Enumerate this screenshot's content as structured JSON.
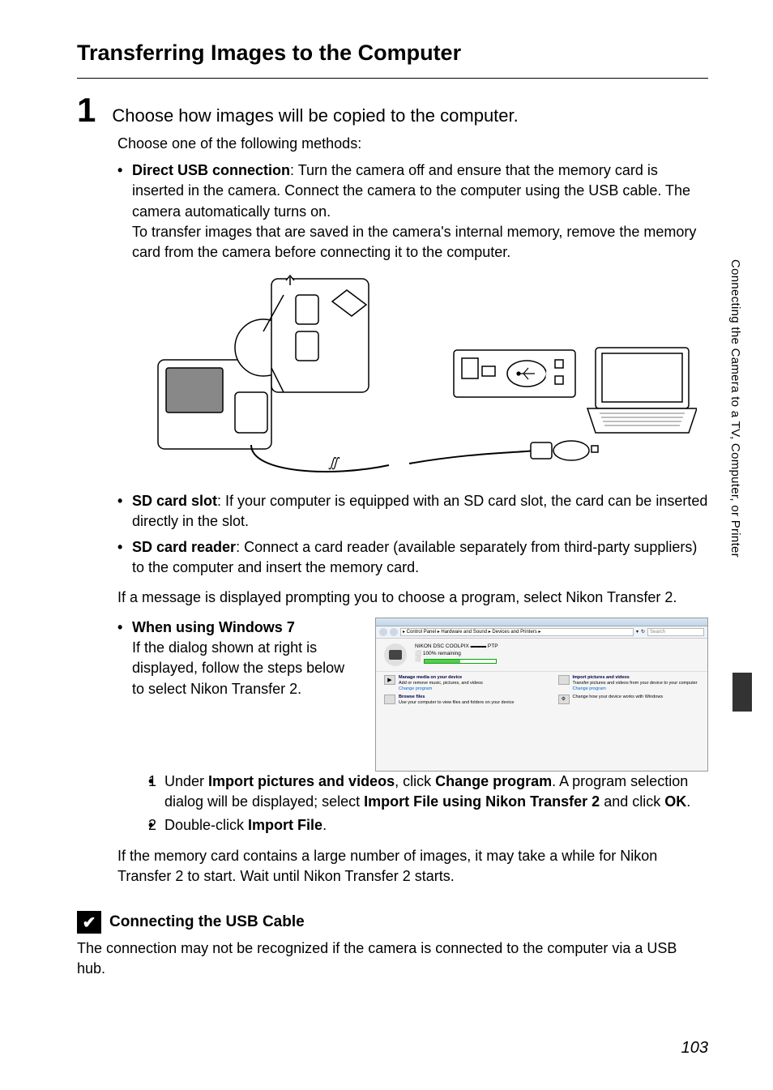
{
  "heading": "Transferring Images to the Computer",
  "step": {
    "number": "1",
    "title": "Choose how images will be copied to the computer.",
    "intro": "Choose one of the following methods:",
    "bullets": {
      "usb": {
        "label": "Direct USB connection",
        "text1": ": Turn the camera off and ensure that the memory card is inserted in the camera. Connect the camera to the computer using the USB cable. The camera automatically turns on.",
        "text2": "To transfer images that are saved in the camera's internal memory, remove the memory card from the camera before connecting it to the computer."
      },
      "sdslot": {
        "label": "SD card slot",
        "text": ": If your computer is equipped with an SD card slot, the card can be inserted directly in the slot."
      },
      "sdreader": {
        "label": "SD card reader",
        "text": ": Connect a card reader (available separately from third-party suppliers) to the computer and insert the memory card."
      }
    },
    "message_para": "If a message is displayed prompting you to choose a program, select Nikon Transfer 2.",
    "win7": {
      "bullet": "When using Windows 7",
      "text": "If the dialog shown at right is displayed, follow the steps below to select Nikon Transfer 2.",
      "list": {
        "item1": {
          "num": "1",
          "pre": "Under ",
          "bold1": "Import pictures and videos",
          "mid1": ", click ",
          "bold2": "Change program",
          "mid2": ". A program selection dialog will be displayed; select ",
          "bold3": "Import File using Nikon Transfer 2",
          "mid3": " and click ",
          "bold4": "OK",
          "end": "."
        },
        "item2": {
          "num": "2",
          "pre": "Double-click ",
          "bold": "Import File",
          "end": "."
        }
      }
    },
    "final_para": "If the memory card contains a large number of images, it may take a while for Nikon Transfer 2 to start. Wait until Nikon Transfer 2 starts."
  },
  "win7_screenshot": {
    "breadcrumb": "▸ Control Panel ▸ Hardware and Sound ▸ Devices and Printers ▸",
    "search": "Search",
    "device_name": "NIKON DSC COOLPIX ▬▬▬ PTP",
    "remaining": "⬜ 100% remaining",
    "manage_title": "Manage media on your device",
    "manage_sub": "Add or remove music, pictures, and videos",
    "manage_link": "Change program",
    "browse_title": "Browse files",
    "browse_sub": "Use your computer to view files and folders on your device",
    "import_title": "Import pictures and videos",
    "import_sub": "Transfer pictures and videos from your device to your computer",
    "import_link": "Change program",
    "changehow_sub": "Change how your device works with Windows"
  },
  "note": {
    "icon": "✔",
    "title": "Connecting the USB Cable",
    "body": "The connection may not be recognized if the camera is connected to the computer via a USB hub."
  },
  "side_text": "Connecting the Camera to a TV, Computer, or Printer",
  "page_number": "103"
}
